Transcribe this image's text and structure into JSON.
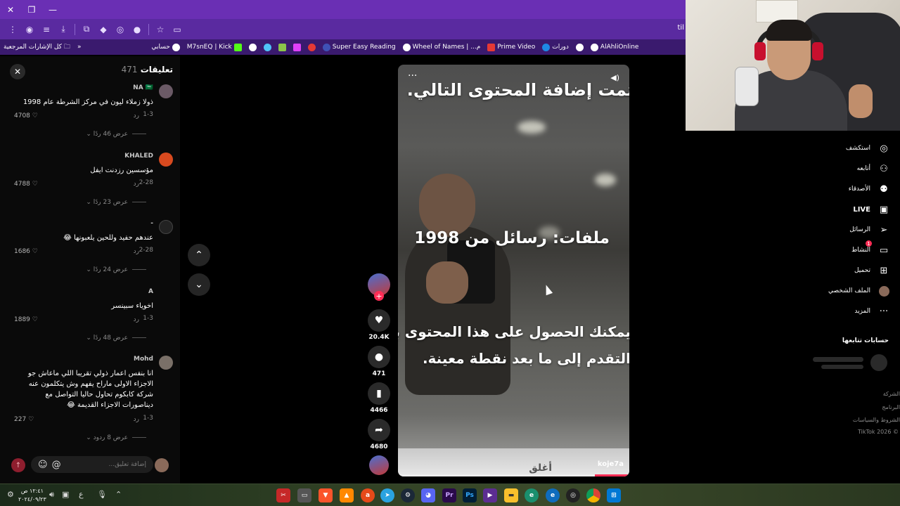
{
  "browser": {
    "url_fragment": "til",
    "bookmarks": [
      {
        "label": "كل الإشارات المرجعية",
        "icon": "folder-icon"
      },
      {
        "label": "حسابي",
        "icon": "globe-icon"
      },
      {
        "label": "M7snEQ | Kick",
        "icon": "kick-icon"
      },
      {
        "label": "",
        "icon": "globe-icon"
      },
      {
        "label": "",
        "icon": "globe-icon"
      },
      {
        "label": "",
        "icon": "globe-icon"
      },
      {
        "label": "Super Easy Reading",
        "icon": "book-icon"
      },
      {
        "label": "Wheel of Names | ...م",
        "icon": "wheel-icon"
      },
      {
        "label": "Prime Video",
        "icon": "prime-icon"
      },
      {
        "label": "دورات",
        "icon": "play-icon"
      },
      {
        "label": "AlAhliOnline",
        "icon": "globe-icon"
      }
    ]
  },
  "comments": {
    "title": "تعليقات",
    "count": "471",
    "input_placeholder": "إضافة تعليق...",
    "items": [
      {
        "user": "NA 🇸🇦",
        "text": "ذولا زملاء ليون في مركز الشرطة عام 1998",
        "date": "1-3",
        "reply": "رد",
        "likes": "4708",
        "view": "عرض 46 ردًا"
      },
      {
        "user": "KHALED",
        "text": "مؤسسين رزدنت ايفل",
        "date": "2-28",
        "reply": "رد",
        "likes": "4788",
        "view": "عرض 23 ردًا"
      },
      {
        "user": "-",
        "text": "عندهم حفيد وللحين يلعبونها 😂",
        "date": "2-28",
        "reply": "رد",
        "likes": "1686",
        "view": "عرض 24 ردًا"
      },
      {
        "user": "A",
        "text": "اخوياء سبينسر",
        "date": "1-3",
        "reply": "رد",
        "likes": "1889",
        "view": "عرض 48 ردًا"
      },
      {
        "user": "Mohd",
        "text": "انا بنفس اعمار ذولي تقريبا اللي ماعاش جو الاجزاء الاولى ماراح يفهم وش يتكلمون عنه شركة كابكوم تحاول حاليا التواصل مع ديناصورات الاجزاء القديمة 😂",
        "date": "1-3",
        "reply": "رد",
        "likes": "227",
        "view": "عرض 8 ردود"
      }
    ]
  },
  "video": {
    "text_top": "تمت إضافة المحتوى التالي.",
    "text_middle": "ملفات: رسائل من 1998",
    "text_bottom_1": "يمكنك الحصول على هذا المحتوى بعد",
    "text_bottom_2": "التقدم إلى ما بعد نقطة معينة.",
    "author": "koje7a",
    "partial_bottom": "أغلق",
    "progress_percent": 15
  },
  "actions": {
    "likes": "20.4K",
    "comments": "471",
    "saves": "4466",
    "shares": "4680"
  },
  "sidebar": {
    "items": [
      {
        "label": "استكشف",
        "icon": "compass-icon"
      },
      {
        "label": "أتابعه",
        "icon": "user-follow-icon"
      },
      {
        "label": "الأصدقاء",
        "icon": "friends-icon"
      },
      {
        "label": "LIVE",
        "icon": "live-icon"
      },
      {
        "label": "الرسائل",
        "icon": "send-icon"
      },
      {
        "label": "النشاط",
        "icon": "activity-icon"
      },
      {
        "label": "تحميل",
        "icon": "upload-icon"
      },
      {
        "label": "الملف الشخصي",
        "icon": "profile-avatar-icon"
      },
      {
        "label": "المزيد",
        "icon": "more-icon"
      }
    ],
    "activity_badge": "1",
    "following_title": "حسابات تتابعها",
    "footer": [
      "الشركة",
      "البرنامج",
      "الشروط والسياسات",
      "TikTok 2026 ©"
    ]
  },
  "taskbar": {
    "time": "١٢:٤١ ص",
    "date": "٢٠٢٤/٠٩/٢٣",
    "lang": "ع"
  },
  "colors": {
    "browser_accent": "#6a2fb4",
    "tiktok_red": "#fe2c55"
  }
}
